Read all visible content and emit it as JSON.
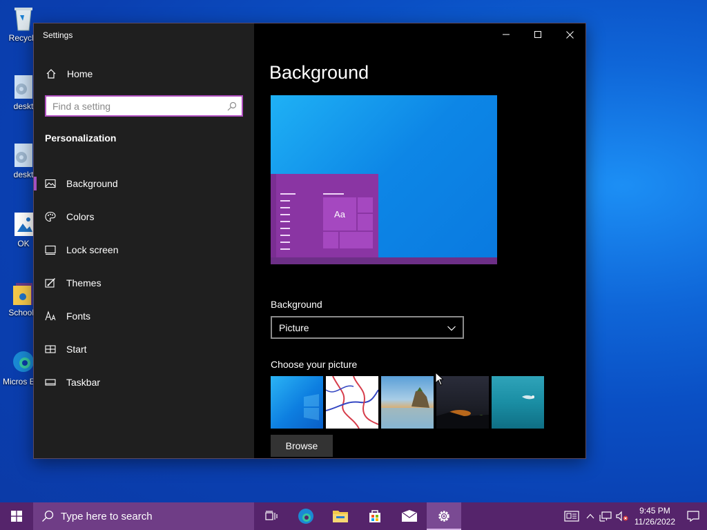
{
  "desktop": {
    "icons": [
      {
        "label": "Recycle"
      },
      {
        "label": "deskt"
      },
      {
        "label": "deskt"
      },
      {
        "label": "OK"
      },
      {
        "label": "School I"
      },
      {
        "label": "Micros Edg"
      }
    ]
  },
  "window": {
    "title": "Settings",
    "controls": {
      "minimize": "minimize",
      "maximize": "maximize",
      "close": "close"
    }
  },
  "sidebar": {
    "home_label": "Home",
    "search_placeholder": "Find a setting",
    "section_title": "Personalization",
    "items": [
      {
        "label": "Background",
        "icon": "picture-icon",
        "active": true
      },
      {
        "label": "Colors",
        "icon": "palette-icon",
        "active": false
      },
      {
        "label": "Lock screen",
        "icon": "lock-screen-icon",
        "active": false
      },
      {
        "label": "Themes",
        "icon": "brush-icon",
        "active": false
      },
      {
        "label": "Fonts",
        "icon": "fonts-icon",
        "active": false
      },
      {
        "label": "Start",
        "icon": "start-icon",
        "active": false
      },
      {
        "label": "Taskbar",
        "icon": "taskbar-icon",
        "active": false
      }
    ]
  },
  "content": {
    "page_title": "Background",
    "preview_sample_text": "Aa",
    "background_label": "Background",
    "background_value": "Picture",
    "choose_label": "Choose your picture",
    "browse_label": "Browse"
  },
  "taskbar": {
    "search_placeholder": "Type here to search",
    "clock_time": "9:45 PM",
    "clock_date": "11/26/2022"
  },
  "colors": {
    "accent": "#a44fc0",
    "taskbar": "#55246b"
  }
}
